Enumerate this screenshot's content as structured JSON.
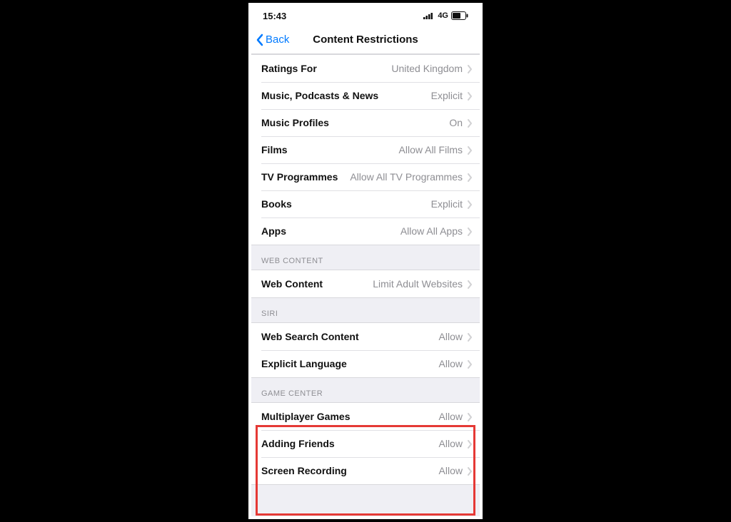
{
  "statusbar": {
    "time": "15:43",
    "network_label": "4G"
  },
  "nav": {
    "back_label": "Back",
    "title": "Content Restrictions"
  },
  "sections": {
    "content": {
      "header": "",
      "rows": [
        {
          "label": "Ratings For",
          "value": "United Kingdom"
        },
        {
          "label": "Music, Podcasts & News",
          "value": "Explicit"
        },
        {
          "label": "Music Profiles",
          "value": "On"
        },
        {
          "label": "Films",
          "value": "Allow All Films"
        },
        {
          "label": "TV Programmes",
          "value": "Allow All TV Programmes"
        },
        {
          "label": "Books",
          "value": "Explicit"
        },
        {
          "label": "Apps",
          "value": "Allow All Apps"
        }
      ]
    },
    "web": {
      "header": "WEB CONTENT",
      "rows": [
        {
          "label": "Web Content",
          "value": "Limit Adult Websites"
        }
      ]
    },
    "siri": {
      "header": "SIRI",
      "rows": [
        {
          "label": "Web Search Content",
          "value": "Allow"
        },
        {
          "label": "Explicit Language",
          "value": "Allow"
        }
      ]
    },
    "gamecenter": {
      "header": "GAME CENTER",
      "rows": [
        {
          "label": "Multiplayer Games",
          "value": "Allow"
        },
        {
          "label": "Adding Friends",
          "value": "Allow"
        },
        {
          "label": "Screen Recording",
          "value": "Allow"
        }
      ]
    }
  }
}
